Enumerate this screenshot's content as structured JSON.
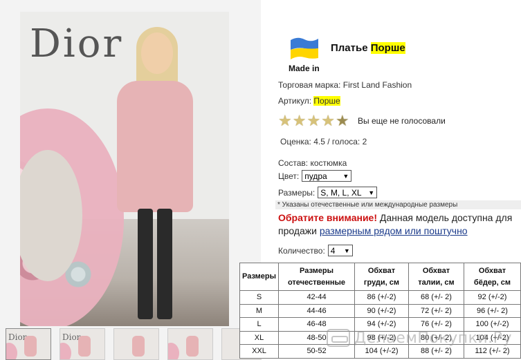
{
  "product": {
    "title_prefix": "Платье",
    "title_highlight": "Порше",
    "made_in": "Made in",
    "flag_colors": [
      "#3a7bd5",
      "#ffd500"
    ],
    "brand_label": "Торговая марка:",
    "brand_value": "First Land Fashion",
    "article_label": "Артикул:",
    "article_value": "Порше",
    "votes_text": "Вы еще не голосовали",
    "rating_text": "Оценка: 4.5 / голоса: 2",
    "rating_value": 4.5,
    "composition_label": "Состав:",
    "composition_value": "костюмка"
  },
  "options": {
    "color_label": "Цвет:",
    "color_value": "пудра",
    "sizes_label": "Размеры:",
    "sizes_value": "S, M, L, XL",
    "sizes_note": "* Указаны отечественные или международные размеры",
    "quantity_label": "Количество:",
    "quantity_value": "4"
  },
  "notice": {
    "warning": "Обратите внимание!",
    "text": "Данная модель доступна для продажи",
    "link": "размерным рядом или поштучно"
  },
  "gallery": {
    "logo_text": "Dior",
    "thumbs": [
      "Dior",
      "Dior",
      "",
      "",
      ""
    ]
  },
  "size_table": {
    "headers": [
      "Размеры",
      "Размеры отечественные",
      "Обхват груди, см",
      "Обхват талии, см",
      "Обхват бёдер, см"
    ],
    "rows": [
      [
        "S",
        "42-44",
        "86 (+/-2)",
        "68 (+/- 2)",
        "92 (+/-2)"
      ],
      [
        "M",
        "44-46",
        "90 (+/-2)",
        "72 (+/- 2)",
        "96 (+/- 2)"
      ],
      [
        "L",
        "46-48",
        "94 (+/-2)",
        "76 (+/- 2)",
        "100 (+/-2)"
      ],
      [
        "XL",
        "48-50",
        "98 (+/-2)",
        "80 (+/- 2)",
        "104 (+/-2)"
      ],
      [
        "XXL",
        "50-52",
        "104 (+/-2)",
        "88 (+/- 2)",
        "112 (+/- 2)"
      ]
    ]
  },
  "watermark": {
    "text": "ДелаемПокупки.Ру"
  }
}
